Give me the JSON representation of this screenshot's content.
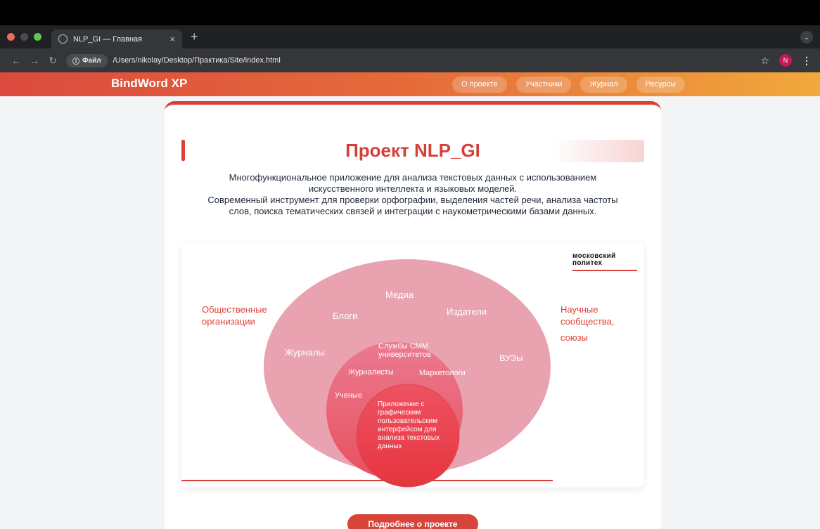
{
  "browser": {
    "tab_title": "NLP_GI — Главная",
    "tab_close": "×",
    "new_tab": "+",
    "tabmenu": "⌄",
    "file_label": "Файл",
    "url": "/Users/nikolay/Desktop/Практика/Site/index.html",
    "avatar_letter": "N",
    "colors": {
      "close": "#ed6a5e",
      "minimize": "#4b4b4b",
      "maximize": "#61c554"
    }
  },
  "header": {
    "logo": "BindWord XP",
    "nav": [
      "О проекте",
      "Участники",
      "Журнал",
      "Ресурсы"
    ],
    "gradient": [
      "#db4a3e",
      "#f1a93b"
    ]
  },
  "main": {
    "title": "Проект NLP_GI",
    "intro_line1": "Многофункциональное приложение для анализа текстовых данных с использованием",
    "intro_line2": "искусственного интеллекта и языковых моделей.",
    "intro_line3": "Современный инструмент для проверки орфографии, выделения частей речи, анализа частоты",
    "intro_line4": "слов, поиска тематических связей и интеграции с наукометрическими базами данных.",
    "more_button": "Подробнее о проекте"
  },
  "diagram": {
    "logo_line1": "московский",
    "logo_line2": "политех",
    "left_label_1": "Общественные",
    "left_label_2": "организации",
    "right_label_1": "Научные",
    "right_label_2": "сообщества,",
    "right_label_3": "союзы",
    "outer": [
      "Медиа",
      "Блоги",
      "Издатели",
      "Журналы",
      "ВУЗы"
    ],
    "middle_smm_1": "Службы СММ",
    "middle_smm_2": "университетов",
    "middle": [
      "Журналисты",
      "Маркетологи",
      "Ученые"
    ],
    "inner_lines": [
      "Приложение с",
      "графическим",
      "пользовательским",
      "интерфейсом для",
      "анализа  текстовых",
      "данных"
    ],
    "colors": {
      "outer": "#e8a2b0",
      "middle": "#ec6f88",
      "inner": "#ea3f54",
      "label_red": "#e04038"
    }
  }
}
